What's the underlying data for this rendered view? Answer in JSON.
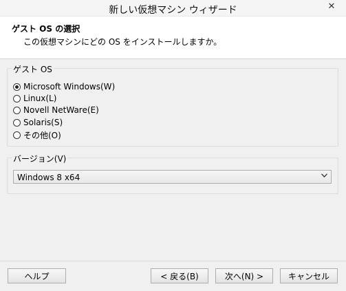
{
  "window": {
    "title": "新しい仮想マシン ウィザード",
    "close_glyph": "✕"
  },
  "header": {
    "title": "ゲスト OS の選択",
    "subtitle": "この仮想マシンにどの OS をインストールしますか。"
  },
  "guest_os": {
    "legend": "ゲスト OS",
    "selected": "Microsoft Windows(W)",
    "options": [
      {
        "label": "Microsoft Windows(W)"
      },
      {
        "label": "Linux(L)"
      },
      {
        "label": "Novell NetWare(E)"
      },
      {
        "label": "Solaris(S)"
      },
      {
        "label": "その他(O)"
      }
    ]
  },
  "version": {
    "legend": "バージョン(V)",
    "value": "Windows 8 x64",
    "arrow_icon": "chevron-down-icon"
  },
  "buttons": {
    "help": "ヘルプ",
    "back": "< 戻る(B)",
    "next": "次へ(N) >",
    "cancel": "キャンセル"
  }
}
